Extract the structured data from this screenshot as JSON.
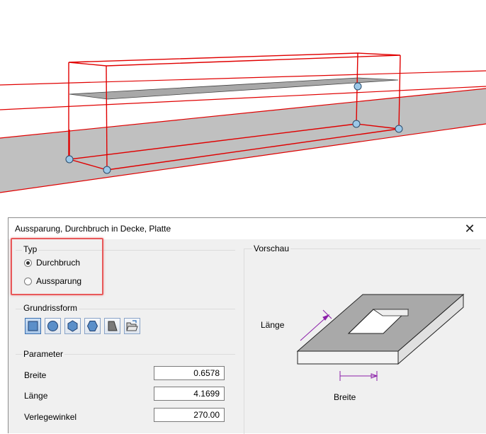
{
  "dialog": {
    "title": "Aussparung, Durchbruch in Decke, Platte",
    "close_symbol": "✕"
  },
  "typ": {
    "label": "Typ",
    "options": [
      {
        "label": "Durchbruch",
        "checked": true
      },
      {
        "label": "Aussparung",
        "checked": false
      }
    ]
  },
  "grundrissform": {
    "label": "Grundrissform",
    "shapes": [
      {
        "icon": "square-icon",
        "active": true
      },
      {
        "icon": "circle-icon",
        "active": false
      },
      {
        "icon": "hexagon-icon",
        "active": false
      },
      {
        "icon": "octagon-icon",
        "active": false
      },
      {
        "icon": "trapezoid-icon",
        "active": false
      },
      {
        "icon": "open-folder-icon",
        "active": false
      }
    ]
  },
  "parameter": {
    "label": "Parameter",
    "fields": [
      {
        "label": "Breite",
        "value": "0.6578"
      },
      {
        "label": "Länge",
        "value": "4.1699"
      },
      {
        "label": "Verlegewinkel",
        "value": "270.00"
      }
    ]
  },
  "vorschau": {
    "label": "Vorschau",
    "laenge_label": "Länge",
    "breite_label": "Breite"
  },
  "colors": {
    "highlight": "#e8595a",
    "wireframe": "#e00000",
    "slab": "#c0c0c0",
    "dimension": "#8b1fa9"
  }
}
